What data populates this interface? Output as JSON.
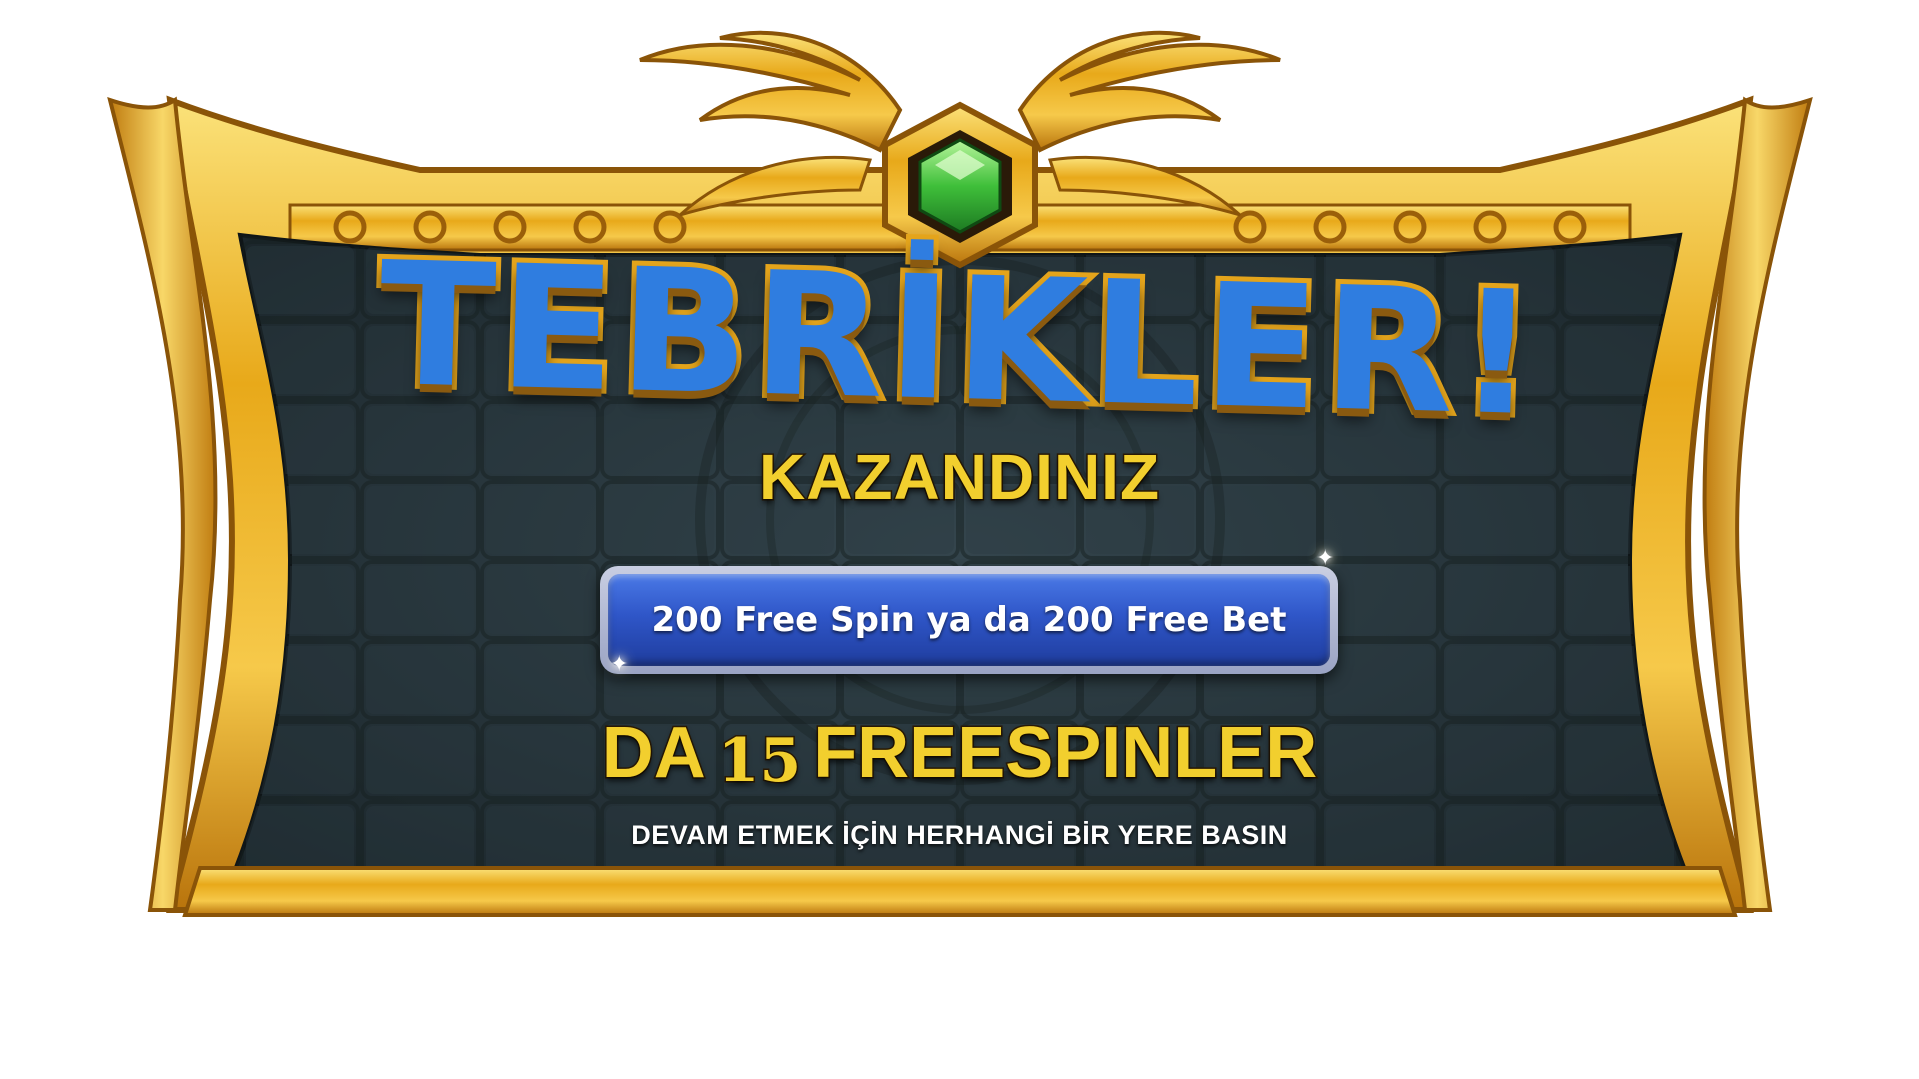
{
  "popup": {
    "title": "TEBRİKLER!",
    "subtitle": "KAZANDINIZ",
    "prize_text": "200 Free Spin ya da 200 Free Bet",
    "award_prefix": "DA",
    "award_count": "15",
    "award_suffix": "FREESPINLER",
    "continue_hint": "DEVAM ETMEK İÇİN HERHANGİ BİR YERE BASIN"
  },
  "icons": {
    "top_gem": "green-gem-icon",
    "wing_left": "golden-wing-icon",
    "wing_right": "golden-wing-icon",
    "sparkle": "sparkle-icon"
  },
  "colors": {
    "frame_gold": "#e8a91a",
    "frame_gold_light": "#f7d35a",
    "panel_dark": "#25333a",
    "title_blue": "#2f7de0",
    "text_yellow": "#f2cf2e",
    "banner_blue": "#2f56c8",
    "gem_green": "#3fbf3a"
  }
}
